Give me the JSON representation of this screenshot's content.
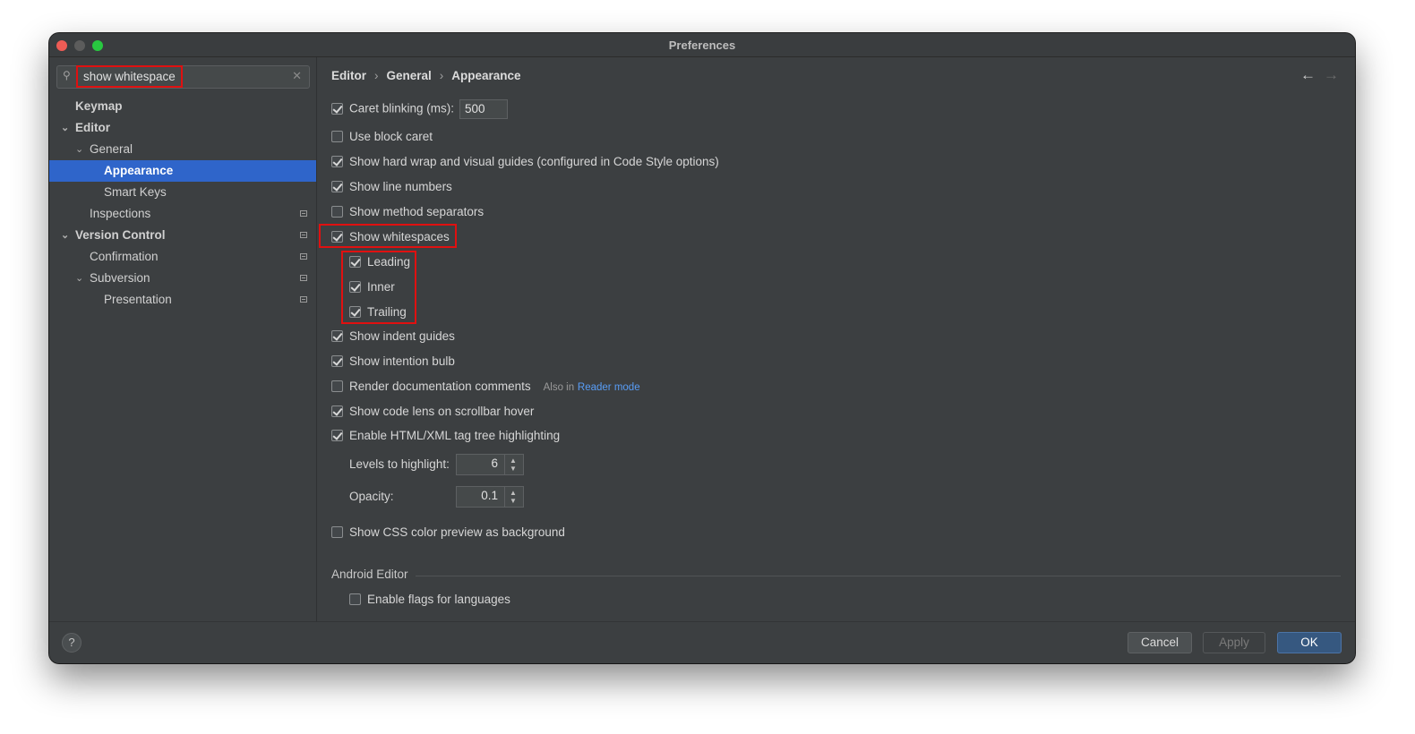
{
  "window": {
    "title": "Preferences"
  },
  "search": {
    "value": "show whitespace",
    "clear_icon": "✕"
  },
  "sidebar": {
    "items": [
      {
        "label": "Keymap"
      },
      {
        "label": "Editor"
      },
      {
        "label": "General"
      },
      {
        "label": "Appearance"
      },
      {
        "label": "Smart Keys"
      },
      {
        "label": "Inspections"
      },
      {
        "label": "Version Control"
      },
      {
        "label": "Confirmation"
      },
      {
        "label": "Subversion"
      },
      {
        "label": "Presentation"
      }
    ]
  },
  "breadcrumb": {
    "items": [
      "Editor",
      "General",
      "Appearance"
    ],
    "separator": "›"
  },
  "nav": {
    "back": "←",
    "forward": "→"
  },
  "options": {
    "caret_blinking": {
      "label": "Caret blinking (ms):",
      "checked": true,
      "value": "500"
    },
    "block_caret": {
      "label": "Use block caret",
      "checked": false
    },
    "hard_wrap": {
      "label": "Show hard wrap and visual guides (configured in Code Style options)",
      "checked": true
    },
    "line_numbers": {
      "label": "Show line numbers",
      "checked": true
    },
    "method_separators": {
      "label": "Show method separators",
      "checked": false
    },
    "whitespaces": {
      "label": "Show whitespaces",
      "checked": true
    },
    "leading": {
      "label": "Leading",
      "checked": true
    },
    "inner": {
      "label": "Inner",
      "checked": true
    },
    "trailing": {
      "label": "Trailing",
      "checked": true
    },
    "indent_guides": {
      "label": "Show indent guides",
      "checked": true
    },
    "intention_bulb": {
      "label": "Show intention bulb",
      "checked": true
    },
    "render_docs": {
      "label": "Render documentation comments",
      "checked": false,
      "note": "Also in",
      "link": "Reader mode"
    },
    "code_lens": {
      "label": "Show code lens on scrollbar hover",
      "checked": true
    },
    "tag_tree": {
      "label": "Enable HTML/XML tag tree highlighting",
      "checked": true
    },
    "levels": {
      "label": "Levels to highlight:",
      "value": "6"
    },
    "opacity": {
      "label": "Opacity:",
      "value": "0.1"
    },
    "css_preview": {
      "label": "Show CSS color preview as background",
      "checked": false
    }
  },
  "android": {
    "section_label": "Android Editor",
    "flags": {
      "label": "Enable flags for languages",
      "checked": false
    }
  },
  "footer": {
    "help": "?",
    "cancel": "Cancel",
    "apply": "Apply",
    "ok": "OK"
  },
  "colors": {
    "selection": "#2f65ca",
    "highlight_box": "#e01010",
    "ok_button": "#365880",
    "link": "#589df6"
  }
}
